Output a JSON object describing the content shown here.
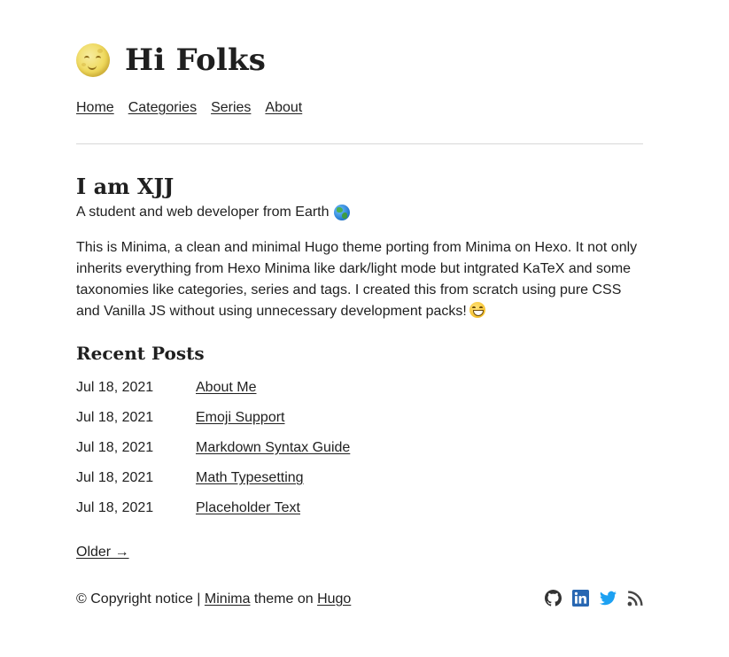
{
  "site": {
    "title": "Hi Folks",
    "logo_icon": "full-moon-face-icon"
  },
  "nav": {
    "items": [
      {
        "label": "Home"
      },
      {
        "label": "Categories"
      },
      {
        "label": "Series"
      },
      {
        "label": "About"
      }
    ]
  },
  "intro": {
    "title": "I am XJJ",
    "subtitle": "A student and web developer from Earth",
    "subtitle_icon": "globe-icon",
    "body": "This is Minima, a clean and minimal Hugo theme porting from Minima on Hexo. It not only inherits everything from Hexo Minima like dark/light mode but intgrated KaTeX and some taxonomies like categories, series and tags. I created this from scratch using pure CSS and Vanilla JS without using unnecessary development packs!",
    "body_icon": "grinning-face-icon"
  },
  "recent": {
    "title": "Recent Posts",
    "posts": [
      {
        "date": "Jul 18, 2021",
        "title": "About Me"
      },
      {
        "date": "Jul 18, 2021",
        "title": "Emoji Support"
      },
      {
        "date": "Jul 18, 2021",
        "title": "Markdown Syntax Guide"
      },
      {
        "date": "Jul 18, 2021",
        "title": "Math Typesetting"
      },
      {
        "date": "Jul 18, 2021",
        "title": "Placeholder Text"
      }
    ],
    "older_label": "Older →"
  },
  "footer": {
    "copyright": "© Copyright notice | ",
    "theme_link": "Minima",
    "middle": " theme on ",
    "engine_link": "Hugo",
    "social": [
      {
        "icon": "github-icon",
        "color": "#333333"
      },
      {
        "icon": "linkedin-icon",
        "color": "#2867b2"
      },
      {
        "icon": "twitter-icon",
        "color": "#1da1f2"
      },
      {
        "icon": "rss-icon",
        "color": "#444444"
      }
    ]
  }
}
